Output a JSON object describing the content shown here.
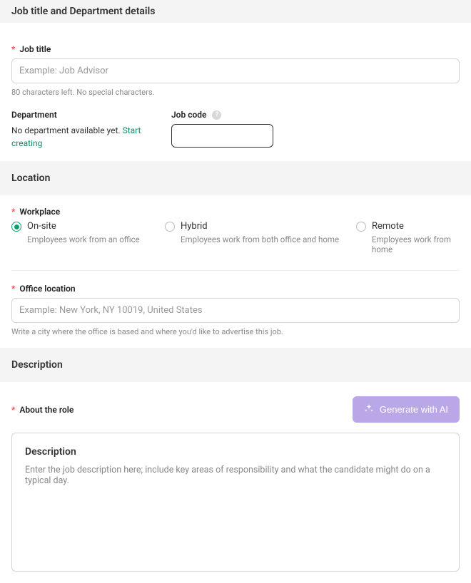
{
  "sections": {
    "jobtitle": {
      "header": "Job title and Department details",
      "title_label": "Job title",
      "title_placeholder": "Example: Job Advisor",
      "title_hint": "80 characters left. No special characters.",
      "department_label": "Department",
      "department_text": "No department available yet. ",
      "department_link": "Start creating",
      "jobcode_label": "Job code"
    },
    "location": {
      "header": "Location",
      "workplace_label": "Workplace",
      "options": [
        {
          "title": "On-site",
          "desc": "Employees work from an office",
          "selected": true
        },
        {
          "title": "Hybrid",
          "desc": "Employees work from both office and home",
          "selected": false
        },
        {
          "title": "Remote",
          "desc": "Employees work from home",
          "selected": false
        }
      ],
      "office_label": "Office location",
      "office_placeholder": "Example: New York, NY 10019, United States",
      "office_hint": "Write a city where the office is based and where you'd like to advertise this job."
    },
    "description": {
      "header": "Description",
      "about_label": "About the role",
      "ai_button": "Generate with AI",
      "editor_title": "Description",
      "editor_placeholder": "Enter the job description here; include key areas of responsibility and what the candidate might do on a typical day."
    }
  }
}
